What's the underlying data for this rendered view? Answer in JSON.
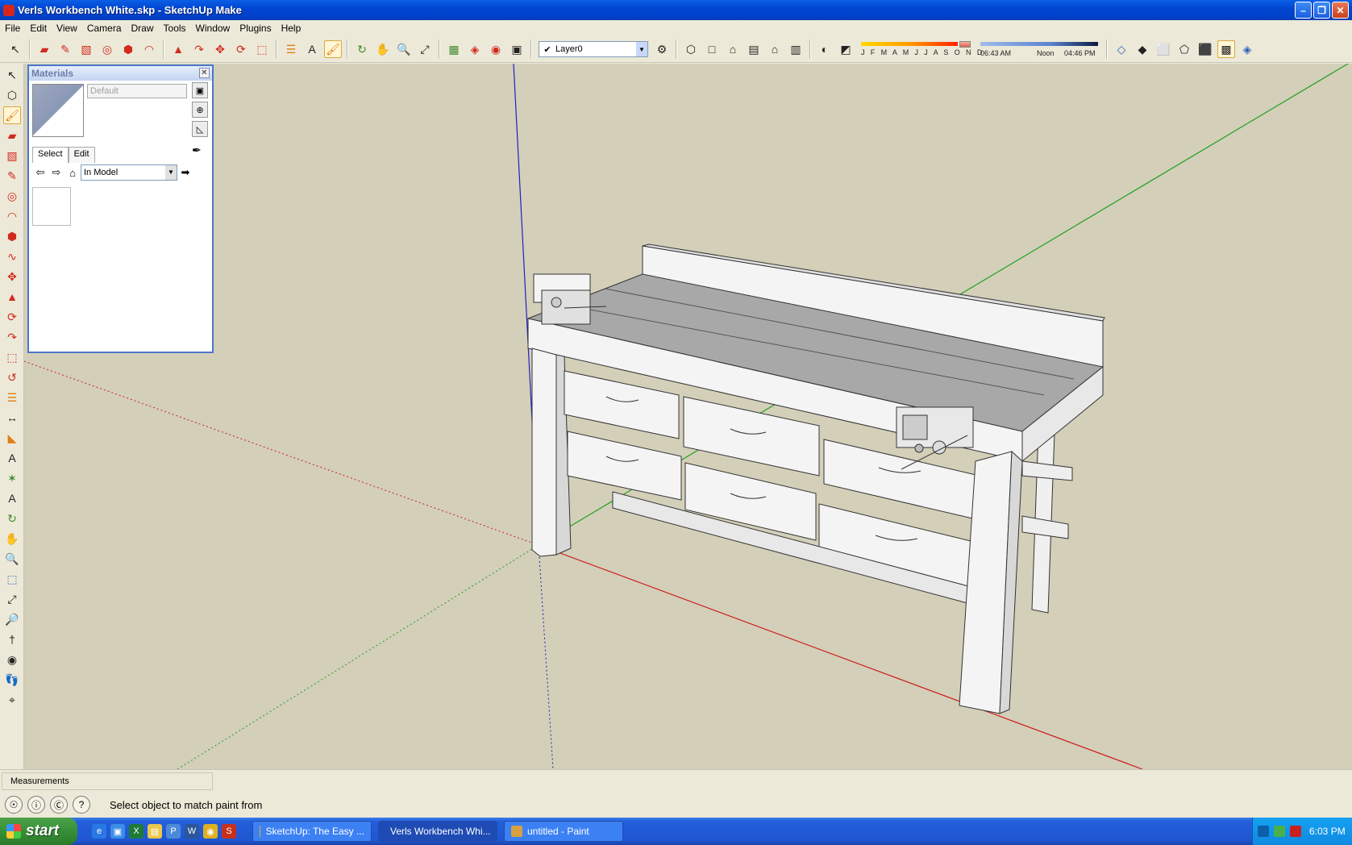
{
  "window": {
    "title": "Verls Workbench White.skp - SketchUp Make",
    "min_glyph": "–",
    "max_glyph": "❐",
    "close_glyph": "✕"
  },
  "menu": [
    "File",
    "Edit",
    "View",
    "Camera",
    "Draw",
    "Tools",
    "Window",
    "Plugins",
    "Help"
  ],
  "toolbar": {
    "layer": "Layer0",
    "layer_check": "✔",
    "months": "J F M A M J J A S O N D",
    "time_start": "06:43 AM",
    "time_mid": "Noon",
    "time_end": "04:46 PM",
    "active_tool": "paint-bucket-icon"
  },
  "materials": {
    "title": "Materials",
    "name_placeholder": "Default",
    "tab_select": "Select",
    "tab_edit": "Edit",
    "collection": "In Model"
  },
  "measurements": {
    "label": "Measurements"
  },
  "status": {
    "text": "Select object to match paint from"
  },
  "taskbar": {
    "start": "start",
    "items": [
      {
        "label": "SketchUp: The Easy ...",
        "active": false
      },
      {
        "label": "Verls Workbench Whi...",
        "active": true
      },
      {
        "label": "untitled - Paint",
        "active": false
      }
    ],
    "clock": "6:03 PM"
  },
  "colors": {
    "viewport_bg": "#d4cfb9",
    "axis_red": "#cc2020",
    "axis_green": "#20a020",
    "axis_blue": "#2020c0",
    "bench_top": "#a8a8a8",
    "bench_white": "#f4f4f4"
  }
}
